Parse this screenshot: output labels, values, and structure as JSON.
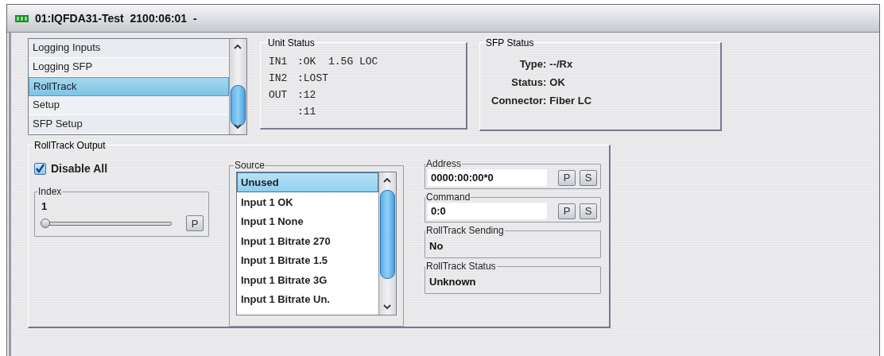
{
  "window": {
    "title": "01:IQFDA31-Test  2100:06:01  -"
  },
  "menu": {
    "items": [
      {
        "label": "Logging Inputs",
        "selected": false
      },
      {
        "label": "Logging SFP",
        "selected": false
      },
      {
        "label": "RollTrack",
        "selected": true
      },
      {
        "label": "Setup",
        "selected": false
      },
      {
        "label": "SFP Setup",
        "selected": false
      }
    ]
  },
  "unit_status": {
    "title": "Unit Status",
    "rows": [
      {
        "label": "IN1",
        "value": ":OK  1.5G LOC"
      },
      {
        "label": "IN2",
        "value": ":LOST"
      },
      {
        "label": "OUT",
        "value": ":12"
      },
      {
        "value": ":11"
      }
    ]
  },
  "sfp_status": {
    "title": "SFP Status",
    "rows": [
      {
        "label": "Type:",
        "value": "--/Rx"
      },
      {
        "label": "Status:",
        "value": "OK"
      },
      {
        "label": "Connector:",
        "value": "Fiber LC"
      }
    ]
  },
  "rolltrack": {
    "title": "RollTrack Output",
    "disable_all": {
      "label": "Disable All",
      "checked": true
    },
    "index": {
      "title": "Index",
      "value": "1",
      "level": 0,
      "button": "P"
    },
    "source": {
      "title": "Source",
      "items": [
        {
          "label": "Unused",
          "selected": true
        },
        {
          "label": "Input 1 OK",
          "selected": false
        },
        {
          "label": "Input 1 None",
          "selected": false
        },
        {
          "label": "Input 1 Bitrate 270",
          "selected": false
        },
        {
          "label": "Input 1 Bitrate 1.5",
          "selected": false
        },
        {
          "label": "Input 1 Bitrate 3G",
          "selected": false
        },
        {
          "label": "Input 1 Bitrate Un.",
          "selected": false
        }
      ]
    },
    "address": {
      "title": "Address",
      "value": "0000:00:00*0",
      "buttons": [
        "P",
        "S"
      ]
    },
    "command": {
      "title": "Command",
      "value": "0:0",
      "buttons": [
        "P",
        "S"
      ]
    },
    "sending": {
      "title": "RollTrack Sending",
      "value": "No"
    },
    "status": {
      "title": "RollTrack Status",
      "value": "Unknown"
    }
  }
}
